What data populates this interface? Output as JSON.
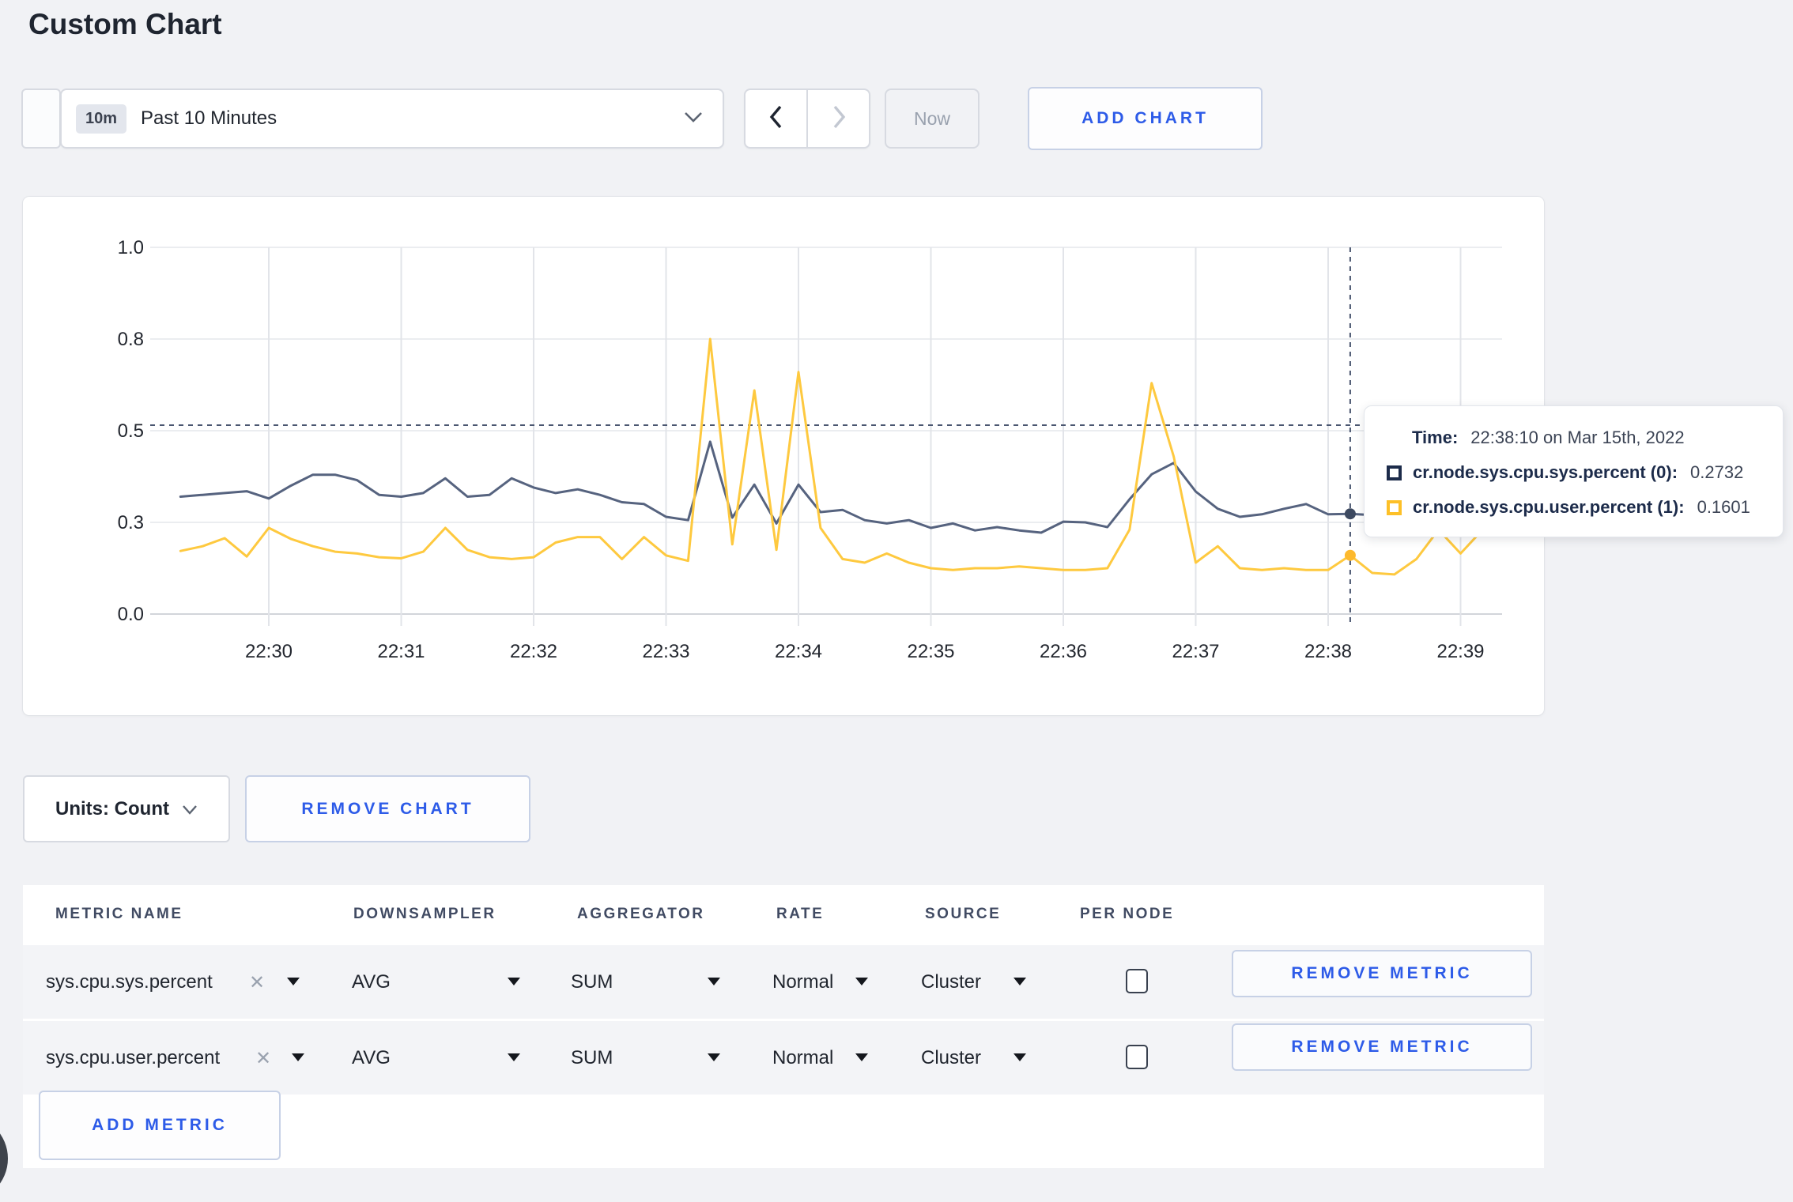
{
  "page": {
    "title": "Custom Chart",
    "background": "#f1f2f5",
    "accent_blue": "#2d5be8"
  },
  "toolbar": {
    "time_range_badge": "10m",
    "time_range_label": "Past 10 Minutes",
    "now_label": "Now",
    "add_chart_label": "ADD CHART"
  },
  "chart_data": {
    "type": "line",
    "title": "",
    "xlabel": "",
    "ylabel": "",
    "grid": true,
    "legend_position": "none",
    "x_axis": {
      "tick_labels": [
        "22:30",
        "22:31",
        "22:32",
        "22:33",
        "22:34",
        "22:35",
        "22:36",
        "22:37",
        "22:38",
        "22:39"
      ]
    },
    "y_axis": {
      "min": 0,
      "max": 1,
      "tick_values": [
        0,
        0.25,
        0.5,
        0.75,
        1.0
      ],
      "tick_labels": [
        "0.0",
        "0.3",
        "0.5",
        "0.8",
        "1.0"
      ]
    },
    "start_time": "22:29:20",
    "interval_seconds": 10,
    "series": [
      {
        "name": "cr.node.sys.cpu.sys.percent (0)",
        "color": "#56637f",
        "values": [
          0.32,
          0.325,
          0.33,
          0.335,
          0.315,
          0.35,
          0.38,
          0.38,
          0.365,
          0.325,
          0.32,
          0.33,
          0.37,
          0.32,
          0.325,
          0.37,
          0.345,
          0.33,
          0.34,
          0.325,
          0.305,
          0.3,
          0.265,
          0.256,
          0.47,
          0.263,
          0.353,
          0.247,
          0.353,
          0.278,
          0.284,
          0.256,
          0.247,
          0.256,
          0.235,
          0.247,
          0.228,
          0.237,
          0.228,
          0.222,
          0.252,
          0.25,
          0.237,
          0.313,
          0.381,
          0.412,
          0.334,
          0.287,
          0.265,
          0.272,
          0.287,
          0.3,
          0.272,
          0.2732,
          0.27,
          0.26,
          0.275,
          0.29,
          0.27,
          0.285
        ]
      },
      {
        "name": "cr.node.sys.cpu.user.percent (1)",
        "color": "#fec93f",
        "values": [
          0.172,
          0.185,
          0.207,
          0.157,
          0.235,
          0.205,
          0.185,
          0.17,
          0.165,
          0.155,
          0.152,
          0.17,
          0.235,
          0.175,
          0.155,
          0.15,
          0.155,
          0.195,
          0.21,
          0.21,
          0.15,
          0.21,
          0.16,
          0.145,
          0.75,
          0.19,
          0.61,
          0.175,
          0.66,
          0.235,
          0.15,
          0.14,
          0.165,
          0.14,
          0.125,
          0.12,
          0.125,
          0.125,
          0.13,
          0.125,
          0.12,
          0.12,
          0.125,
          0.23,
          0.63,
          0.43,
          0.14,
          0.185,
          0.125,
          0.12,
          0.125,
          0.12,
          0.12,
          0.1601,
          0.112,
          0.108,
          0.15,
          0.23,
          0.165,
          0.23
        ]
      }
    ],
    "crosshair": {
      "time": "22:38:10",
      "mouse_value_y": 0.515,
      "points": [
        {
          "value": 0.2732,
          "color": "#3d4960"
        },
        {
          "value": 0.1601,
          "color": "#fdb92d"
        }
      ]
    }
  },
  "tooltip": {
    "time_label": "Time:",
    "time_value": "22:38:10 on Mar 15th, 2022",
    "rows": [
      {
        "name": "cr.node.sys.cpu.sys.percent (0):",
        "value": "0.2732",
        "color": "#1c2b4a"
      },
      {
        "name": "cr.node.sys.cpu.user.percent (1):",
        "value": "0.1601",
        "color": "#fdc028"
      }
    ]
  },
  "chart_controls": {
    "units_label": "Units: Count",
    "remove_chart_label": "REMOVE CHART"
  },
  "metrics_table": {
    "headers": [
      "METRIC NAME",
      "DOWNSAMPLER",
      "AGGREGATOR",
      "RATE",
      "SOURCE",
      "PER NODE"
    ],
    "rows": [
      {
        "metric": "sys.cpu.sys.percent",
        "downsampler": "AVG",
        "aggregator": "SUM",
        "rate": "Normal",
        "source": "Cluster",
        "per_node_checked": false,
        "remove_label": "REMOVE METRIC"
      },
      {
        "metric": "sys.cpu.user.percent",
        "downsampler": "AVG",
        "aggregator": "SUM",
        "rate": "Normal",
        "source": "Cluster",
        "per_node_checked": false,
        "remove_label": "REMOVE METRIC"
      }
    ],
    "add_metric_label": "ADD METRIC"
  }
}
